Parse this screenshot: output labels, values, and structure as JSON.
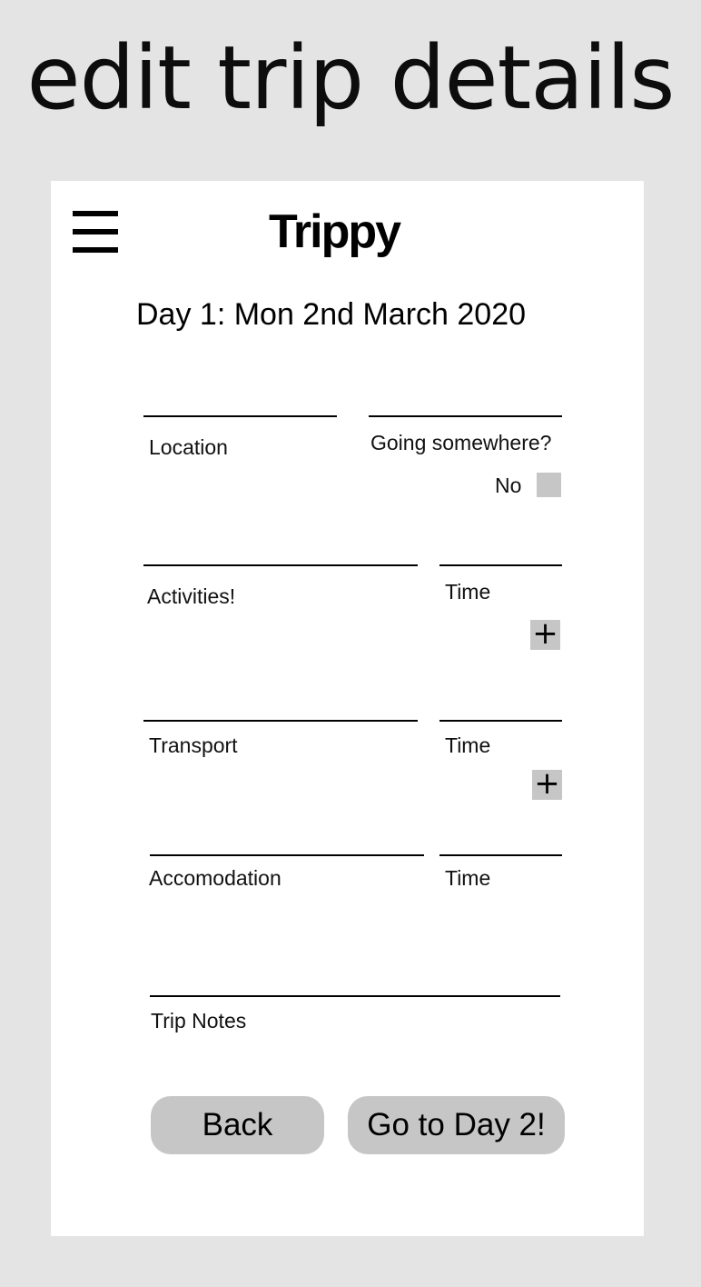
{
  "page": {
    "heading": "edit trip details"
  },
  "app": {
    "logo": "Trippy",
    "day_title": "Day 1: Mon 2nd March 2020"
  },
  "form": {
    "location_label": "Location",
    "going_label": "Going somewhere?",
    "going_value_label": "No",
    "activities_label": "Activities!",
    "activities_time_label": "Time",
    "transport_label": "Transport",
    "transport_time_label": "Time",
    "accommodation_label": "Accomodation",
    "accommodation_time_label": "Time",
    "notes_label": "Trip Notes",
    "add_symbol": "+"
  },
  "actions": {
    "back_label": "Back",
    "next_label": "Go to Day 2!"
  },
  "colors": {
    "background": "#e4e4e4",
    "card": "#ffffff",
    "control_gray": "#c6c6c6"
  },
  "icons": {
    "menu": "hamburger-menu-icon",
    "add": "plus-icon"
  }
}
